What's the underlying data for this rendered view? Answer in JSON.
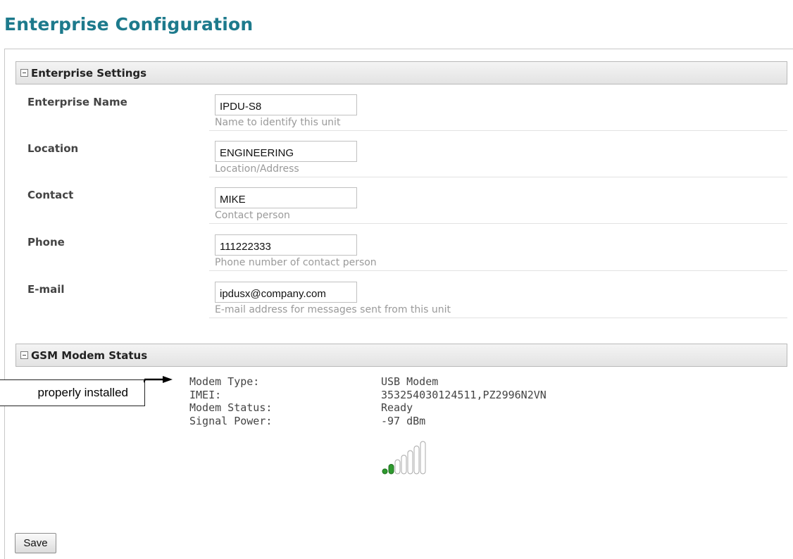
{
  "page": {
    "title": "Enterprise Configuration"
  },
  "enterprise_settings": {
    "title": "Enterprise Settings",
    "fields": [
      {
        "label": "Enterprise Name",
        "value": "IPDU-S8",
        "hint": "Name to identify this unit"
      },
      {
        "label": "Location",
        "value": "ENGINEERING",
        "hint": "Location/Address"
      },
      {
        "label": "Contact",
        "value": "MIKE",
        "hint": "Contact person"
      },
      {
        "label": "Phone",
        "value": "111222333",
        "hint": "Phone number of contact person"
      },
      {
        "label": "E-mail",
        "value": "ipdusx@company.com",
        "hint": "E-mail address for messages sent from this unit"
      }
    ]
  },
  "gsm_modem_status": {
    "title": "GSM Modem Status",
    "rows": [
      {
        "key": "Modem Type:",
        "value": "USB Modem"
      },
      {
        "key": "IMEI:",
        "value": "353254030124511,PZ2996N2VN"
      },
      {
        "key": "Modem Status:",
        "value": "Ready"
      },
      {
        "key": "Signal Power:",
        "value": "-97 dBm"
      }
    ],
    "signal_bars_total": 7,
    "signal_bars_active": 2,
    "signal_active_color": "#2e9a2e"
  },
  "callout": {
    "text": "properly installed"
  },
  "actions": {
    "save_label": "Save"
  }
}
